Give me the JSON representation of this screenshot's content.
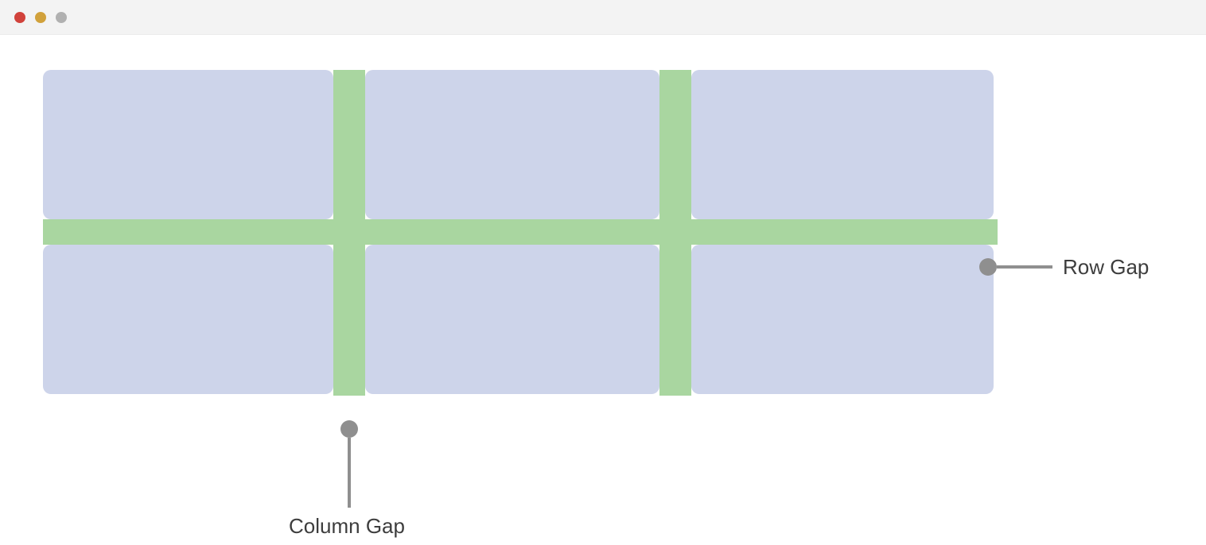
{
  "window": {
    "traffic_lights": [
      "red",
      "yellow",
      "gray"
    ]
  },
  "diagram": {
    "cell_color": "#cdd4ea",
    "gap_color": "#a9d6a0",
    "callout_color": "#8f8f8f",
    "labels": {
      "row_gap": "Row Gap",
      "column_gap": "Column Gap"
    }
  }
}
